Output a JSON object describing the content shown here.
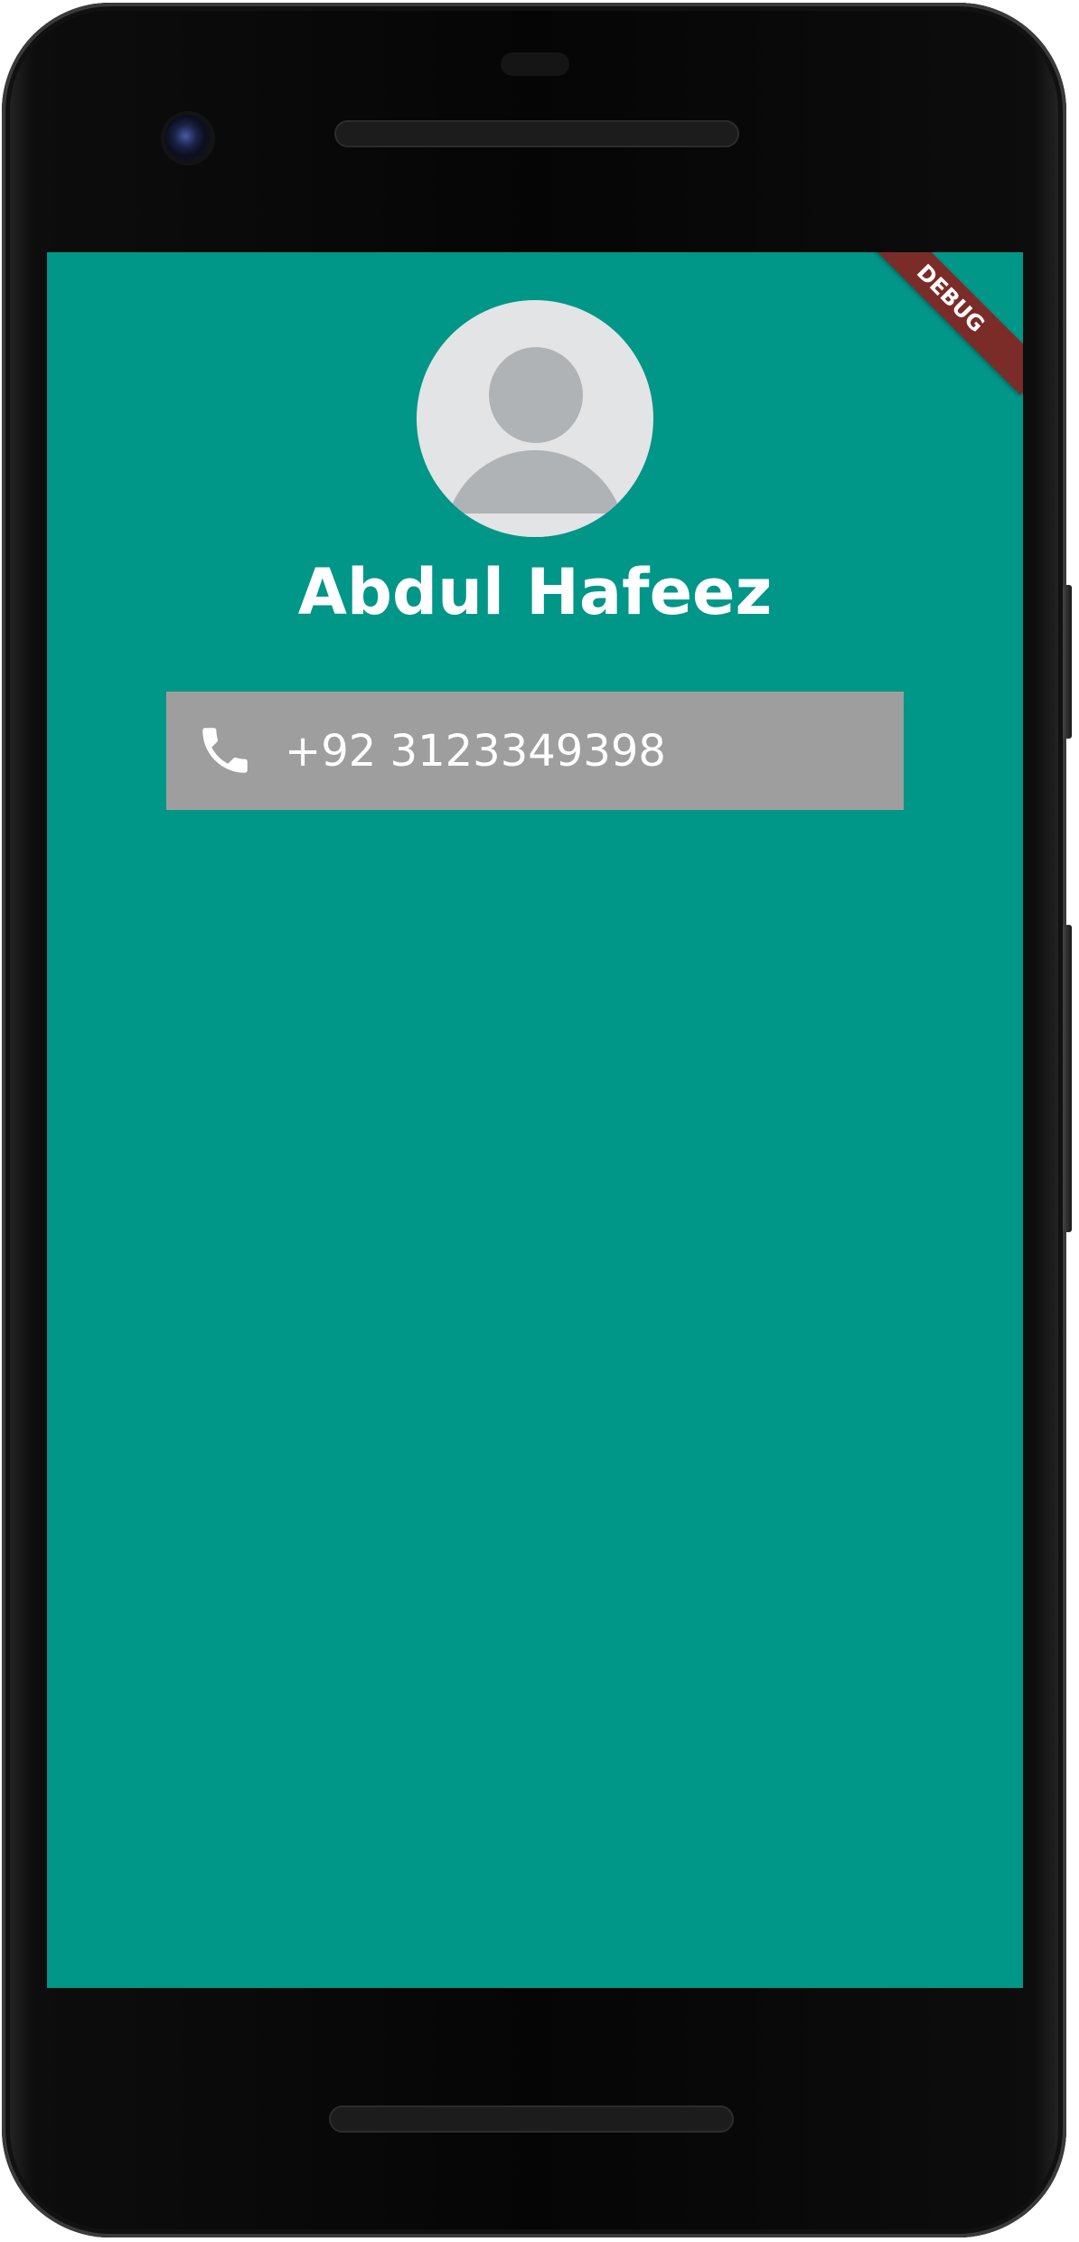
{
  "contact": {
    "name": "Abdul Hafeez",
    "phone": "+92 3123349398"
  },
  "banner": {
    "label": "DEBUG"
  },
  "icons": {
    "avatar": "person-placeholder-icon",
    "phone": "phone-icon"
  },
  "colors": {
    "background": "#009688",
    "card": "#9e9e9e",
    "banner": "#7b2c28",
    "text": "#ffffff",
    "avatar_bg": "#e3e4e6",
    "avatar_fg": "#b0b3b6"
  }
}
